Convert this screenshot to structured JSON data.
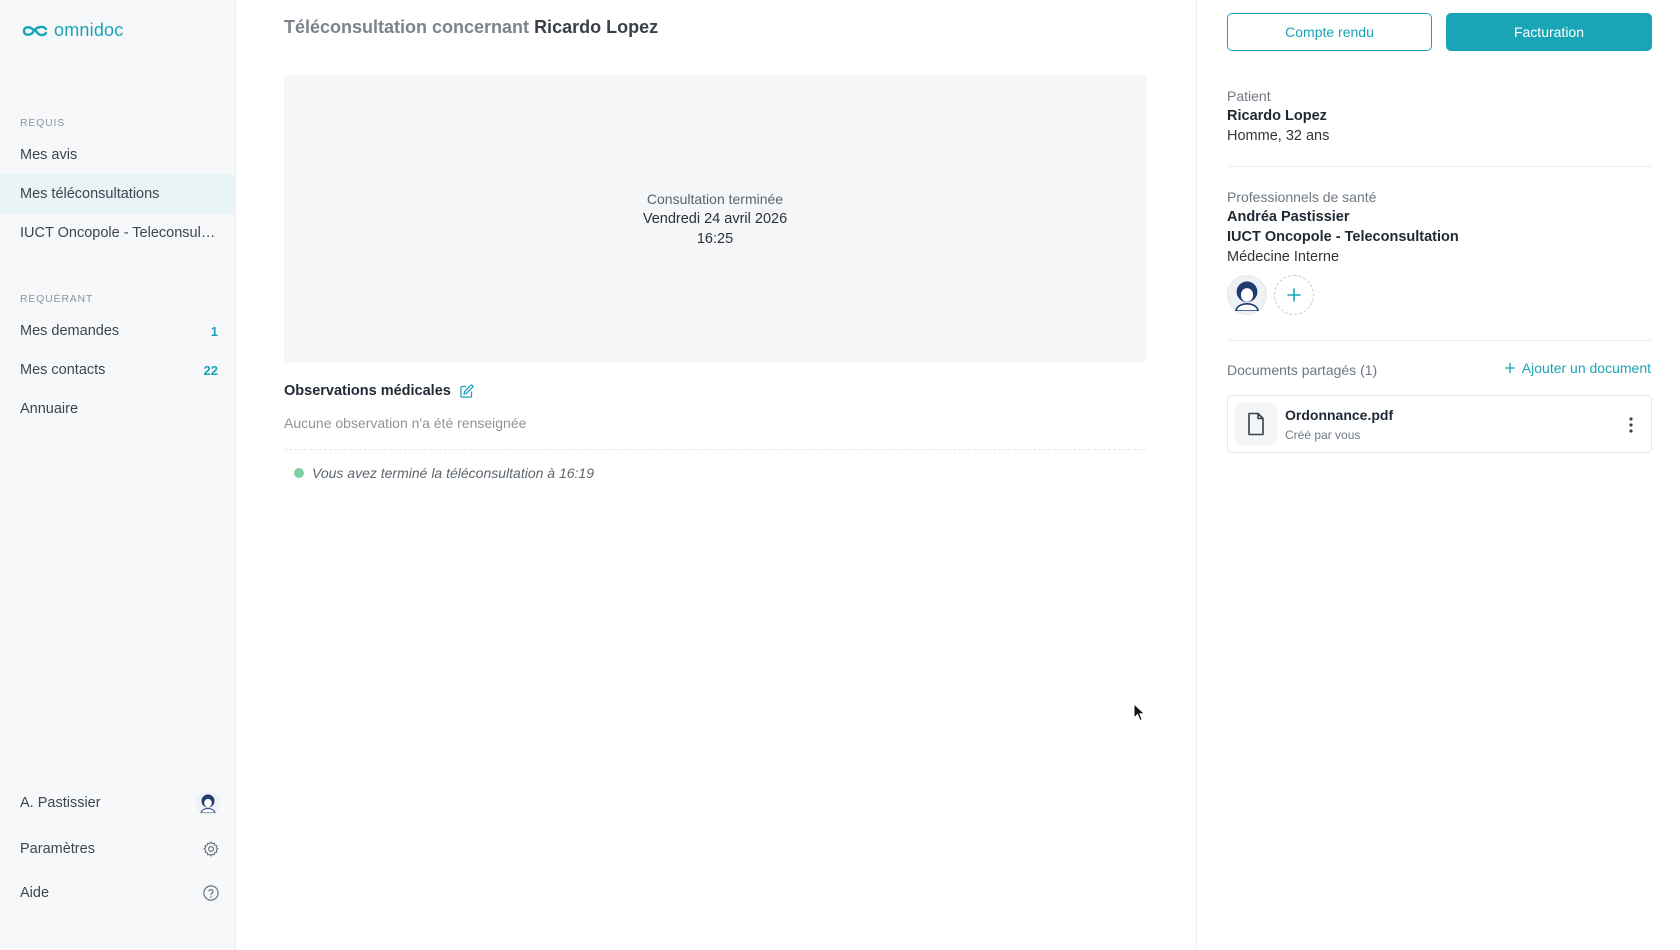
{
  "brand": {
    "name": "omnidoc",
    "color": "#1aa5b7"
  },
  "sidebar": {
    "requis_label": "REQUIS",
    "requis_items": [
      {
        "label": "Mes avis"
      },
      {
        "label": "Mes téléconsultations",
        "active": true
      },
      {
        "label": "IUCT Oncopole - Teleconsultation"
      }
    ],
    "requerant_label": "REQUÉRANT",
    "requerant_items": [
      {
        "label": "Mes demandes",
        "count": "1"
      },
      {
        "label": "Mes contacts",
        "count": "22"
      },
      {
        "label": "Annuaire"
      }
    ],
    "bottom": {
      "user": "A. Pastissier",
      "settings": "Paramètres",
      "help": "Aide"
    }
  },
  "main": {
    "title_prefix": "Téléconsultation concernant",
    "title_patient": "Ricardo Lopez",
    "status": "Consultation terminée",
    "date": "Vendredi 24 avril 2026",
    "time": "16:25",
    "observations_title": "Observations médicales",
    "observations_empty": "Aucune observation n'a été renseignée",
    "event_text": "Vous avez terminé la téléconsultation à 16:19",
    "event_color": "#7cd0a4"
  },
  "right": {
    "report_button": "Compte rendu",
    "billing_button": "Facturation",
    "patient_label": "Patient",
    "patient_name": "Ricardo Lopez",
    "patient_details": "Homme, 32 ans",
    "professionals_label": "Professionnels de santé",
    "professional_name": "Andréa Pastissier",
    "professional_org": "IUCT Oncopole - Teleconsultation",
    "professional_specialty": "Médecine Interne",
    "documents_label": "Documents partagés (1)",
    "add_document": "Ajouter un document",
    "document": {
      "name": "Ordonnance.pdf",
      "author": "Créé par vous"
    }
  }
}
